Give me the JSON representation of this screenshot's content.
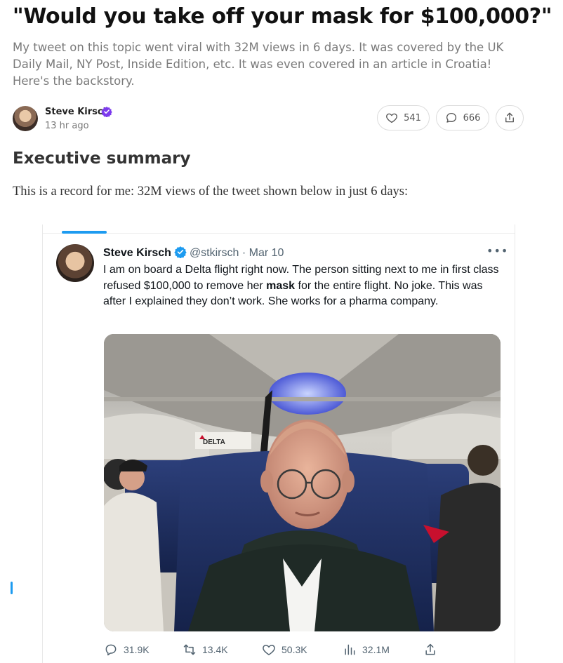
{
  "post": {
    "title": "\"Would you take off your mask for $100,000?\"",
    "subtitle": "My tweet on this topic went viral with 32M views in 6 days. It was covered by the UK Daily Mail, NY Post, Inside Edition, etc. It was even covered in an article in Croatia! Here's the backstory.",
    "author": {
      "name": "Steve Kirsch",
      "time": "13 hr ago"
    },
    "likes": "541",
    "comments": "666",
    "section_heading": "Executive summary",
    "body_text": "This is a record for me: 32M views of the tweet shown below in just 6 days:"
  },
  "tweet": {
    "name": "Steve Kirsch",
    "handle": "@stkirsch",
    "separator": "·",
    "date": "Mar 10",
    "more": "•••",
    "text_before": "I am on board a Delta flight right now. The person sitting next to me in first class refused $100,000 to remove her ",
    "text_bold": "mask",
    "text_after": " for the entire flight. No joke. This was after I explained they don’t work. She works for a pharma company.",
    "photo_sign": "DELTA",
    "replies": "31.9K",
    "retweets": "13.4K",
    "likes": "50.3K",
    "views": "32.1M"
  },
  "icons": {
    "verified_post": "verified-purple-badge",
    "verified_tweet": "verified-blue-badge",
    "like": "heart-icon",
    "comment": "comment-bubble-icon",
    "share": "share-upload-icon",
    "reply": "reply-icon",
    "retweet": "retweet-icon",
    "views": "views-bar-chart-icon"
  },
  "colors": {
    "verified_post": "#7c3aed",
    "verified_tweet": "#1d9bf0",
    "twitter_blue": "#1d9bf0",
    "delta_red": "#c8102e"
  }
}
